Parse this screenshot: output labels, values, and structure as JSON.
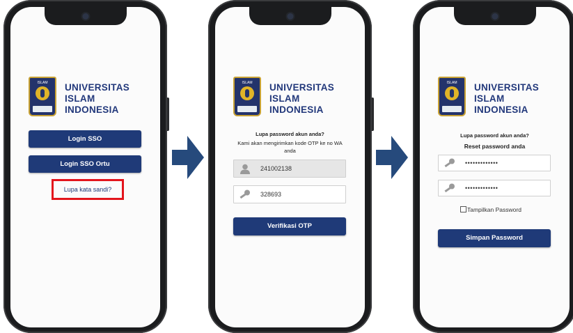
{
  "brand": {
    "line1": "UNIVERSITAS",
    "line2": "ISLAM",
    "line3": "INDONESIA",
    "crest_text": "ISLAM"
  },
  "screen1": {
    "login_sso": "Login SSO",
    "login_sso_ortu": "Login SSO Ortu",
    "forgot_link": "Lupa kata sandi?"
  },
  "screen2": {
    "heading": "Lupa password akun anda?",
    "desc_line1": "Kami akan mengirimkan kode OTP ke no WA",
    "desc_line2": "anda",
    "user_value": "241002138",
    "otp_value": "328693",
    "verify_button": "Verifikasi OTP"
  },
  "screen3": {
    "heading": "Lupa password akun anda?",
    "subheading": "Reset password anda",
    "password1": "•••••••••••••",
    "password2": "•••••••••••••",
    "show_password": "Tampilkan Password",
    "save_button": "Simpan Password"
  },
  "colors": {
    "primary": "#1f3a78",
    "highlight": "#e3151c",
    "arrow": "#264a7c",
    "brand_text": "#22387b"
  },
  "icons": [
    "user-icon",
    "key-icon",
    "right-arrow-icon"
  ]
}
